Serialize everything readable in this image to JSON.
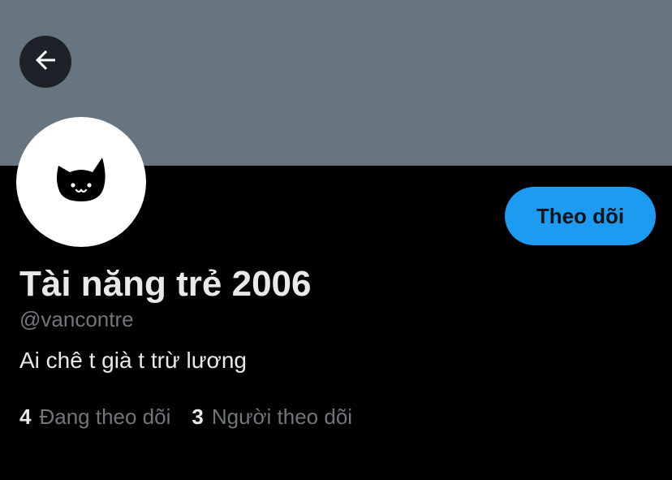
{
  "header": {
    "back_icon": "arrow-left-icon",
    "banner_color": "#66757f"
  },
  "profile": {
    "avatar_icon": "cat-face-icon",
    "display_name": "Tài năng trẻ 2006",
    "handle": "@vancontre",
    "bio": "Ai chê t già t trừ lương",
    "follow_button_label": "Theo dõi",
    "accent_color": "#1d9bf0"
  },
  "stats": {
    "following_count": "4",
    "following_label": "Đang theo dõi",
    "followers_count": "3",
    "followers_label": "Người theo dõi"
  }
}
